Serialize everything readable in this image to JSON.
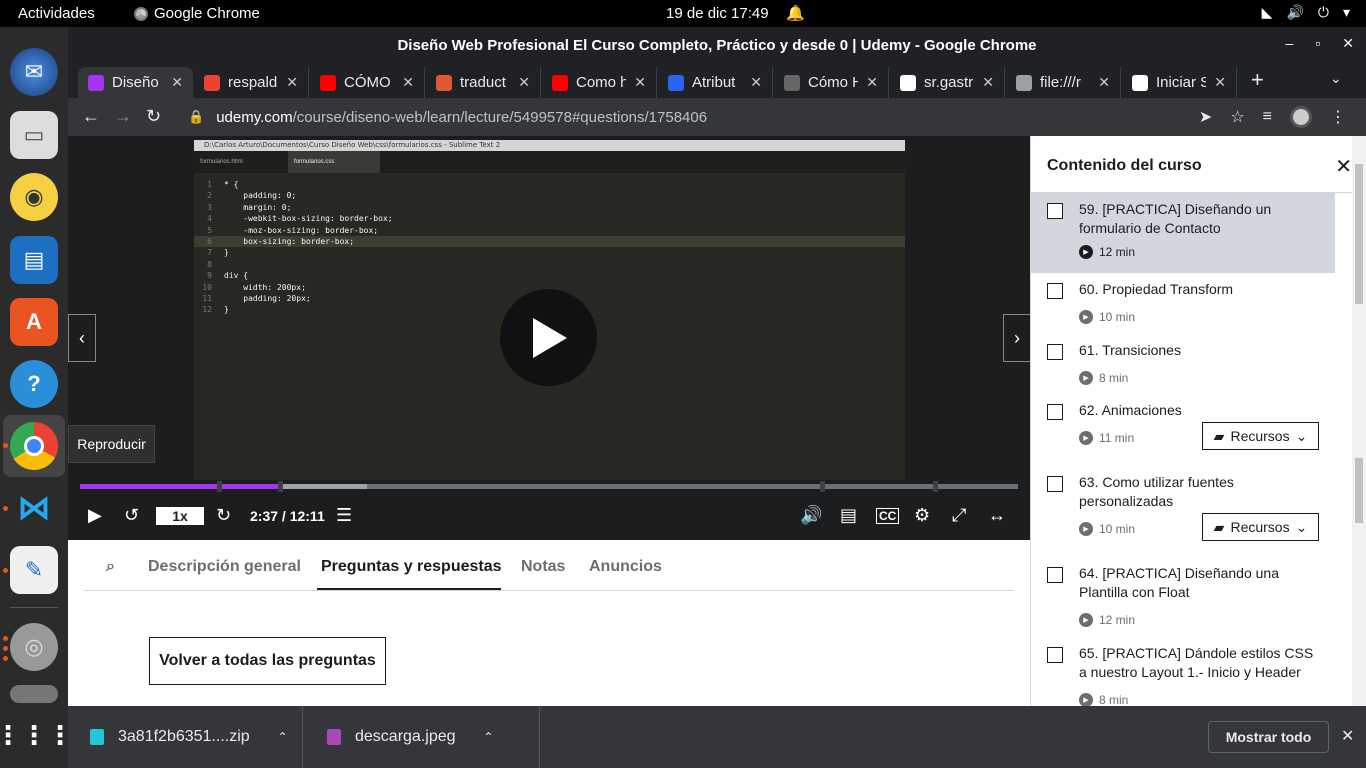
{
  "topbar": {
    "activities": "Actividades",
    "app": "Google Chrome",
    "clock": "19 de dic  17:49"
  },
  "window": {
    "title": "Diseño Web Profesional El Curso Completo, Práctico y desde 0 | Udemy - Google Chrome"
  },
  "tabs": [
    {
      "label": "Diseño",
      "icon": "udemy-icon",
      "color": "#a435f0"
    },
    {
      "label": "respald",
      "icon": "gmail-icon",
      "color": "#ea4335"
    },
    {
      "label": "CÓMO t",
      "icon": "youtube-icon",
      "color": "#ff0000"
    },
    {
      "label": "traduct",
      "icon": "duckduckgo-icon",
      "color": "#de5833"
    },
    {
      "label": "Como h",
      "icon": "youtube-icon",
      "color": "#ff0000"
    },
    {
      "label": "Atribut",
      "icon": "css3-icon",
      "color": "#2965f1"
    },
    {
      "label": "Cómo H",
      "icon": "site-icon",
      "color": "#666666"
    },
    {
      "label": "sr.gastr",
      "icon": "site-icon",
      "color": "#ffffff"
    },
    {
      "label": "file:///r",
      "icon": "globe-icon",
      "color": "#9aa0a6"
    },
    {
      "label": "Iniciar S",
      "icon": "login-icon",
      "color": "#ffffff"
    }
  ],
  "address": {
    "host": "udemy.com",
    "path": "/course/diseno-web/learn/lecture/5499578#questions/1758406"
  },
  "editor": {
    "titlebar": "D:\\Carlos Arturo\\Documentos\\Curso Diseño Web\\css\\formularios.css - Sublime Text 2",
    "tab1": "formularios.html",
    "tab2": "formularios.css",
    "lines": [
      {
        "n": "1",
        "t": "* {"
      },
      {
        "n": "2",
        "t": "    padding: 0;"
      },
      {
        "n": "3",
        "t": "    margin: 0;"
      },
      {
        "n": "4",
        "t": "    -webkit-box-sizing: border-box;"
      },
      {
        "n": "5",
        "t": "    -moz-box-sizing: border-box;"
      },
      {
        "n": "6",
        "t": "    box-sizing: border-box;"
      },
      {
        "n": "7",
        "t": "}"
      },
      {
        "n": "8",
        "t": ""
      },
      {
        "n": "9",
        "t": "div {"
      },
      {
        "n": "10",
        "t": "    width: 200px;"
      },
      {
        "n": "11",
        "t": "    padding: 20px;"
      },
      {
        "n": "12",
        "t": "}"
      }
    ]
  },
  "player": {
    "tooltip": "Reproducir",
    "rate": "1x",
    "time": "2:37 / 12:11",
    "progress_fraction": 0.2149
  },
  "subtabs": [
    "Descripción general",
    "Preguntas y respuestas",
    "Notas",
    "Anuncios"
  ],
  "back_button": "Volver a todas las preguntas",
  "sidebar": {
    "title": "Contenido del curso",
    "lessons": [
      {
        "title": "59. [PRACTICA] Diseñando un formulario de Contacto",
        "duration": "12 min",
        "current": true
      },
      {
        "title": "60. Propiedad Transform",
        "duration": "10 min"
      },
      {
        "title": "61. Transiciones",
        "duration": "8 min"
      },
      {
        "title": "62. Animaciones",
        "duration": "11 min",
        "resources": "Recursos"
      },
      {
        "title": "63. Como utilizar fuentes personalizadas",
        "duration": "10 min",
        "resources": "Recursos"
      },
      {
        "title": "64. [PRACTICA] Diseñando una Plantilla con Float",
        "duration": "12 min"
      },
      {
        "title": "65. [PRACTICA] Dándole estilos CSS a nuestro Layout 1.- Inicio y Header",
        "duration": "8 min"
      }
    ]
  },
  "downloads": [
    {
      "name": "3a81f2b6351....zip",
      "color": "#26c6da"
    },
    {
      "name": "descarga.jpeg",
      "color": "#ab47bc"
    }
  ],
  "show_all": "Mostrar todo",
  "colors": {
    "accent": "#a435f0"
  }
}
